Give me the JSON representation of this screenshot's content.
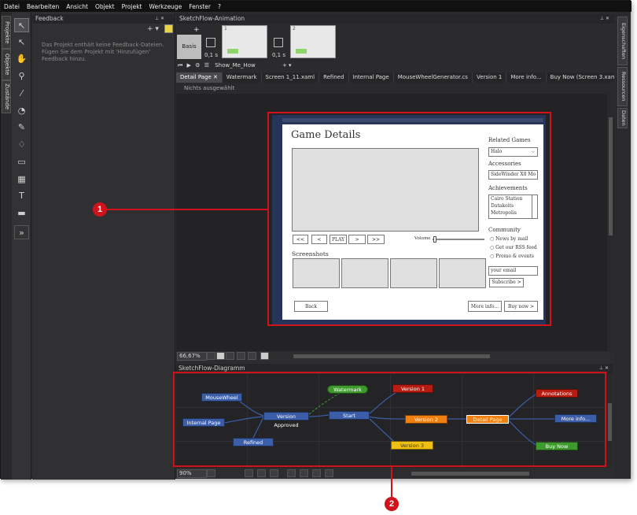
{
  "menu": [
    "Datei",
    "Bearbeiten",
    "Ansicht",
    "Objekt",
    "Projekt",
    "Werkzeuge",
    "Fenster",
    "?"
  ],
  "left_tabs": [
    "Projekte",
    "Objekte",
    "Zustände"
  ],
  "feedback": {
    "title": "Feedback",
    "message": "Das Projekt enthält keine Feedback-Dateien. Fügen Sie dem Projekt mit 'Hinzufügen' Feedback hinzu."
  },
  "animation": {
    "title": "SketchFlow-Animation",
    "basis_label": "Basis",
    "duration1": "0,1 s",
    "duration2": "0,1 s",
    "thumb1_num": "1",
    "thumb2_num": "2",
    "show_name": "Show_Me_How",
    "plus": "+"
  },
  "doc_tabs": [
    "Detail Page",
    "Watermark",
    "Screen 1_11.xaml",
    "Refined",
    "Internal Page",
    "MouseWheelGenerator.cs",
    "Version 1",
    "More info...",
    "Buy Now (Screen 3.xaml)"
  ],
  "breadcrumb": "Nichts ausgewählt",
  "sketch": {
    "title": "Game Details",
    "related_label": "Related Games",
    "related_value": "Halo",
    "accessories_label": "Accessories",
    "accessories_value": "SideWinder X8 Mo",
    "achievements_label": "Achievements",
    "achievements": [
      "Cairo Station",
      "Datakoits",
      "Metropolis"
    ],
    "community_label": "Community",
    "community_options": [
      "News by mail",
      "Get our RSS feed",
      "Promo & events"
    ],
    "email_placeholder": "your email",
    "subscribe": "Subscribe >",
    "controls": [
      "<<",
      "<",
      "PLAY",
      ">",
      ">>"
    ],
    "volume_label": "Volume",
    "screenshots_label": "Screenshots",
    "back": "Back",
    "more_info": "More info...",
    "buy_now": "Buy now >"
  },
  "zoom": "66,67%",
  "diagram": {
    "title": "SketchFlow-Diagramm",
    "zoom": "90%",
    "nodes": [
      {
        "label": "MouseWheel",
        "color": "#3c5ea8"
      },
      {
        "label": "Internal Page",
        "color": "#3c5ea8"
      },
      {
        "label": "Version Approved",
        "color": "#3c5ea8"
      },
      {
        "label": "Refined",
        "color": "#3c5ea8"
      },
      {
        "label": "Watermark",
        "color": "#3f9a2e"
      },
      {
        "label": "Start",
        "color": "#3c5ea8"
      },
      {
        "label": "Version 1",
        "color": "#b81c10"
      },
      {
        "label": "Version 2",
        "color": "#f08010"
      },
      {
        "label": "Version 3",
        "color": "#f0c010"
      },
      {
        "label": "Detail Page",
        "color": "#f08010"
      },
      {
        "label": "Annotations",
        "color": "#b81c10"
      },
      {
        "label": "More info...",
        "color": "#3c5ea8"
      },
      {
        "label": "Buy Now",
        "color": "#3f9a2e"
      }
    ]
  },
  "right_tabs": [
    "Eigenschaften",
    "Ressourcen",
    "Daten"
  ],
  "callouts": [
    "1",
    "2"
  ]
}
